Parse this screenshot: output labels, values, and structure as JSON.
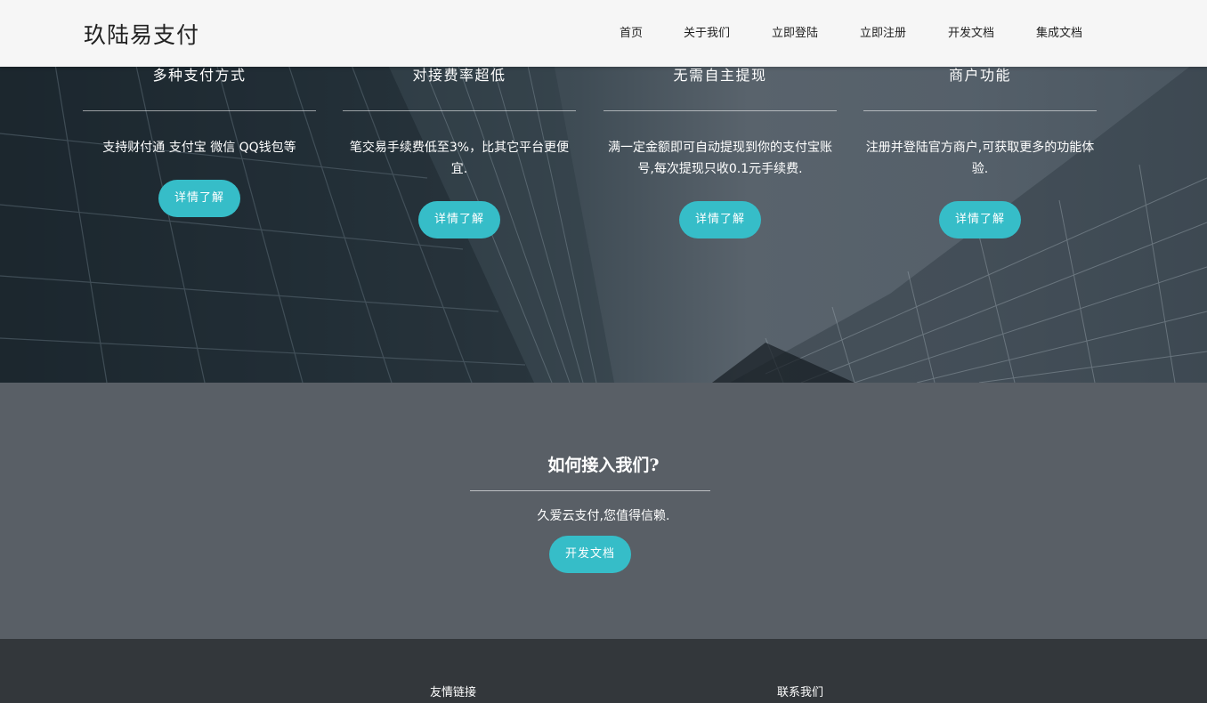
{
  "header": {
    "logo": "玖陆易支付",
    "nav": [
      {
        "label": "首页"
      },
      {
        "label": "关于我们"
      },
      {
        "label": "立即登陆"
      },
      {
        "label": "立即注册"
      },
      {
        "label": "开发文档"
      },
      {
        "label": "集成文档"
      }
    ]
  },
  "features": [
    {
      "title": "多种支付方式",
      "desc": "支持财付通 支付宝 微信 QQ钱包等",
      "button": "详情了解"
    },
    {
      "title": "对接费率超低",
      "desc": "笔交易手续费低至3%，比其它平台更便宜.",
      "button": "详情了解"
    },
    {
      "title": "无需自主提现",
      "desc": "满一定金额即可自动提现到你的支付宝账号,每次提现只收0.1元手续费.",
      "button": "详情了解"
    },
    {
      "title": "商户功能",
      "desc": "注册并登陆官方商户,可获取更多的功能体验.",
      "button": "详情了解"
    }
  ],
  "join": {
    "title": "如何接入我们?",
    "desc": "久爱云支付,您值得信赖.",
    "button": "开发文档"
  },
  "footer": {
    "links_heading": "友情链接",
    "contact_heading": "联系我们"
  },
  "colors": {
    "accent": "#36bdc8",
    "header_bg": "#f6f6f6",
    "join_bg": "#595f66",
    "footer_bg": "#33373b"
  }
}
